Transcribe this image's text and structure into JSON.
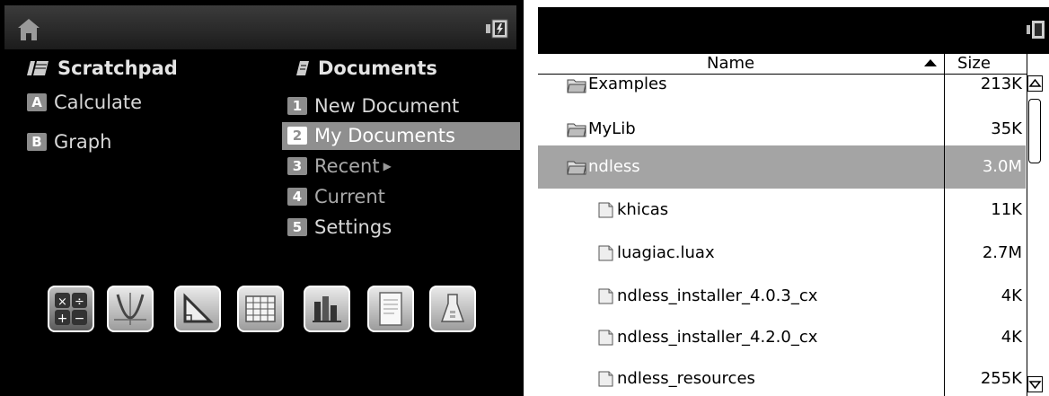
{
  "left": {
    "scratchpad": {
      "title": "Scratchpad",
      "items": [
        {
          "key": "A",
          "label": "Calculate"
        },
        {
          "key": "B",
          "label": "Graph"
        }
      ]
    },
    "documents": {
      "title": "Documents",
      "items": [
        {
          "key": "1",
          "label": "New Document"
        },
        {
          "key": "2",
          "label": "My Documents",
          "selected": true
        },
        {
          "key": "3",
          "label": "Recent",
          "submenu": true
        },
        {
          "key": "4",
          "label": "Current"
        },
        {
          "key": "5",
          "label": "Settings"
        }
      ]
    },
    "apps": [
      "calculator-icon",
      "graphs-icon",
      "geometry-icon",
      "lists-spreadsheet-icon",
      "data-statistics-icon",
      "notes-icon",
      "vernier-dataquest-icon"
    ]
  },
  "right": {
    "columns": {
      "name": "Name",
      "size": "Size"
    },
    "rows": [
      {
        "name": "Examples",
        "size": "213K",
        "type": "folder"
      },
      {
        "name": "MyLib",
        "size": "35K",
        "type": "folder"
      },
      {
        "name": "ndless",
        "size": "3.0M",
        "type": "folder-open",
        "selected": true
      },
      {
        "name": "khicas",
        "size": "11K",
        "type": "file"
      },
      {
        "name": "luagiac.luax",
        "size": "2.7M",
        "type": "file"
      },
      {
        "name": "ndless_installer_4.0.3_cx",
        "size": "4K",
        "type": "file"
      },
      {
        "name": "ndless_installer_4.2.0_cx",
        "size": "4K",
        "type": "file"
      },
      {
        "name": "ndless_resources",
        "size": "255K",
        "type": "file"
      }
    ]
  },
  "colors": {
    "selected_left": "#8f8f8f",
    "selected_right": "#a4a4a4",
    "background_left": "#000000"
  }
}
